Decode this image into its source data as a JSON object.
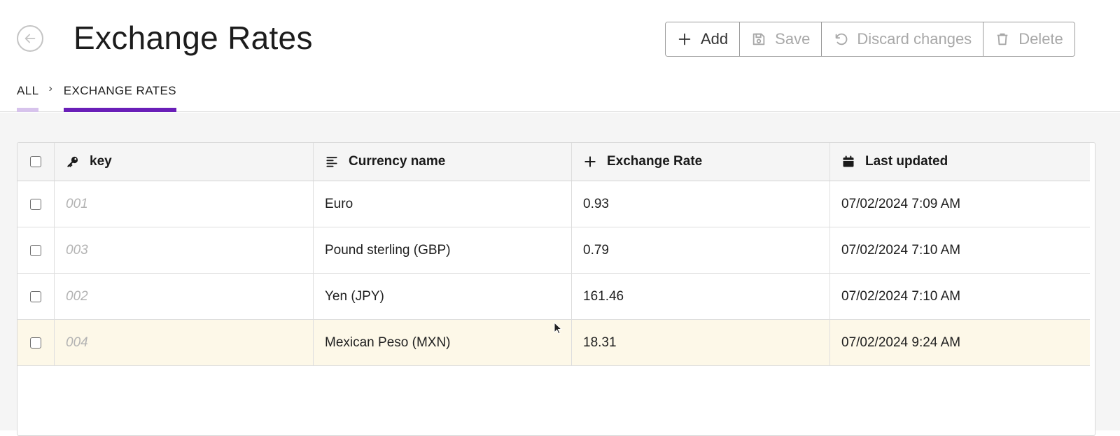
{
  "page": {
    "title": "Exchange Rates"
  },
  "toolbar": {
    "add_label": "Add",
    "save_label": "Save",
    "discard_label": "Discard changes",
    "delete_label": "Delete"
  },
  "breadcrumb": {
    "all": "ALL",
    "separator": "›",
    "current": "EXCHANGE RATES"
  },
  "table": {
    "columns": [
      {
        "label": "key",
        "icon": "key-icon"
      },
      {
        "label": "Currency name",
        "icon": "text-align-left-icon"
      },
      {
        "label": "Exchange Rate",
        "icon": "plus-icon"
      },
      {
        "label": "Last updated",
        "icon": "calendar-icon"
      }
    ],
    "rows": [
      {
        "key": "001",
        "currency": "Euro",
        "rate": "0.93",
        "updated": "07/02/2024 7:09 AM"
      },
      {
        "key": "003",
        "currency": "Pound sterling (GBP)",
        "rate": "0.79",
        "updated": "07/02/2024 7:10 AM"
      },
      {
        "key": "002",
        "currency": "Yen (JPY)",
        "rate": "161.46",
        "updated": "07/02/2024 7:10 AM"
      },
      {
        "key": "004",
        "currency": "Mexican Peso (MXN)",
        "rate": "18.31",
        "updated": "07/02/2024 9:24 AM"
      }
    ]
  },
  "colors": {
    "accent": "#6a1fb8",
    "accent_light": "#d7c3ec",
    "highlight_row": "#fdf8e8"
  }
}
